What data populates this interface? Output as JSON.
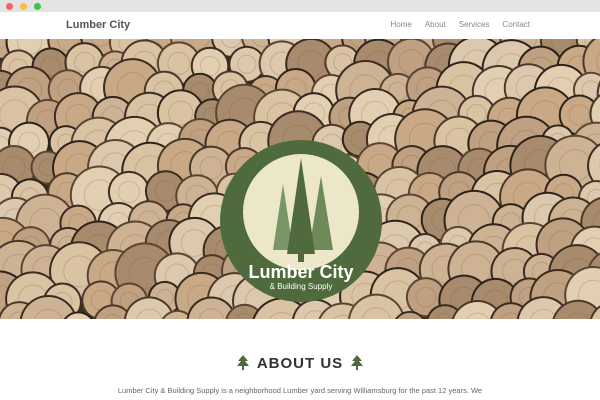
{
  "navbar": {
    "brand": "Lumber City",
    "links": [
      "Home",
      "About",
      "Services",
      "Contact"
    ]
  },
  "hero": {
    "logo_title": "Lumber City",
    "logo_subtitle": "& Building Supply"
  },
  "about": {
    "heading": "ABOUT US",
    "text": "Lumber City & Building Supply is a neighborhood Lumber yard serving Williamsburg for the past 12 years. We"
  },
  "colors": {
    "logo_green": "#4f6b3e",
    "logo_cream": "#ece7c9",
    "tree_green": "#4f6b3e"
  },
  "icons": {
    "heading_left": "tree-icon",
    "heading_right": "tree-icon"
  }
}
